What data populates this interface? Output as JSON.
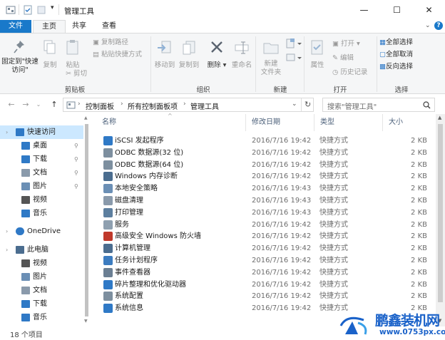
{
  "title": "管理工具",
  "ribbon_tabs": [
    "文件",
    "主页",
    "共享",
    "查看"
  ],
  "window": {
    "minimize": "—",
    "maximize": "☐",
    "close": "✕"
  },
  "ribbon": {
    "clipboard": {
      "pin_label": "固定到\"快速访问\"",
      "copy": "复制",
      "paste": "粘贴",
      "cut": "剪切",
      "copy_path": "复制路径",
      "paste_shortcut": "粘贴快捷方式",
      "group": "剪贴板"
    },
    "organize": {
      "move_to": "移动到",
      "copy_to": "复制到",
      "delete": "删除",
      "rename": "重命名",
      "group": "组织"
    },
    "new": {
      "new_folder": "新建\n文件夹",
      "group": "新建"
    },
    "open": {
      "properties": "属性",
      "open": "打开",
      "edit": "编辑",
      "history": "历史记录",
      "group": "打开"
    },
    "select": {
      "select_all": "全部选择",
      "select_none": "全部取消",
      "invert": "反向选择",
      "group": "选择"
    }
  },
  "address": {
    "crumbs": [
      "控制面板",
      "所有控制面板项",
      "管理工具"
    ],
    "separator": "›",
    "search_placeholder": "搜索\"管理工具\""
  },
  "sidebar": {
    "items": [
      {
        "label": "快速访问",
        "icon": "star-icon",
        "level": 0,
        "selected": true
      },
      {
        "label": "桌面",
        "icon": "desktop-icon",
        "level": 1,
        "pinned": true
      },
      {
        "label": "下载",
        "icon": "download-icon",
        "level": 1,
        "pinned": true
      },
      {
        "label": "文档",
        "icon": "document-icon",
        "level": 1,
        "pinned": true
      },
      {
        "label": "图片",
        "icon": "picture-icon",
        "level": 1,
        "pinned": true
      },
      {
        "label": "视频",
        "icon": "video-icon",
        "level": 1
      },
      {
        "label": "音乐",
        "icon": "music-icon",
        "level": 1
      },
      {
        "label": "OneDrive",
        "icon": "cloud-icon",
        "level": 0
      },
      {
        "label": "此电脑",
        "icon": "computer-icon",
        "level": 0
      },
      {
        "label": "视频",
        "icon": "video-icon",
        "level": 1
      },
      {
        "label": "图片",
        "icon": "picture-icon",
        "level": 1
      },
      {
        "label": "文档",
        "icon": "document-icon",
        "level": 1
      },
      {
        "label": "下载",
        "icon": "download-icon",
        "level": 1
      },
      {
        "label": "音乐",
        "icon": "music-icon",
        "level": 1
      }
    ],
    "pin_glyph": "📌"
  },
  "columns": [
    "名称",
    "修改日期",
    "类型",
    "大小"
  ],
  "files": [
    {
      "name": "iSCSI 发起程序",
      "date": "2016/7/16 19:42",
      "type": "快捷方式",
      "size": "2 KB"
    },
    {
      "name": "ODBC 数据源(32 位)",
      "date": "2016/7/16 19:42",
      "type": "快捷方式",
      "size": "2 KB"
    },
    {
      "name": "ODBC 数据源(64 位)",
      "date": "2016/7/16 19:42",
      "type": "快捷方式",
      "size": "2 KB"
    },
    {
      "name": "Windows 内存诊断",
      "date": "2016/7/16 19:42",
      "type": "快捷方式",
      "size": "2 KB"
    },
    {
      "name": "本地安全策略",
      "date": "2016/7/16 19:43",
      "type": "快捷方式",
      "size": "2 KB"
    },
    {
      "name": "磁盘清理",
      "date": "2016/7/16 19:43",
      "type": "快捷方式",
      "size": "2 KB"
    },
    {
      "name": "打印管理",
      "date": "2016/7/16 19:43",
      "type": "快捷方式",
      "size": "2 KB"
    },
    {
      "name": "服务",
      "date": "2016/7/16 19:42",
      "type": "快捷方式",
      "size": "2 KB"
    },
    {
      "name": "高级安全 Windows 防火墙",
      "date": "2016/7/16 19:42",
      "type": "快捷方式",
      "size": "2 KB"
    },
    {
      "name": "计算机管理",
      "date": "2016/7/16 19:42",
      "type": "快捷方式",
      "size": "2 KB"
    },
    {
      "name": "任务计划程序",
      "date": "2016/7/16 19:42",
      "type": "快捷方式",
      "size": "2 KB"
    },
    {
      "name": "事件查看器",
      "date": "2016/7/16 19:42",
      "type": "快捷方式",
      "size": "2 KB"
    },
    {
      "name": "碎片整理和优化驱动器",
      "date": "2016/7/16 19:42",
      "type": "快捷方式",
      "size": "2 KB"
    },
    {
      "name": "系统配置",
      "date": "2016/7/16 19:42",
      "type": "快捷方式",
      "size": "2 KB"
    },
    {
      "name": "系统信息",
      "date": "2016/7/16 19:42",
      "type": "快捷方式",
      "size": "2 KB"
    }
  ],
  "status": "18 个项目",
  "watermark": {
    "brand": "鹏鑫装机网",
    "url": "www.0753px.com"
  },
  "colors": {
    "accent": "#1979ca",
    "selected_bg": "#cce8ff",
    "header_text": "#4c607a",
    "watermark": "#1a62c9"
  }
}
